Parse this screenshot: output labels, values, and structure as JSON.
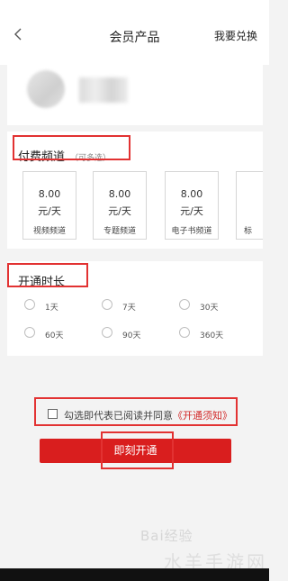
{
  "header": {
    "title": "会员产品",
    "redeem_link": "我要兑换",
    "back_icon": "chevron-left-icon"
  },
  "profile": {
    "avatar": "avatar-blurred",
    "username": ""
  },
  "channels": {
    "title": "付费频道",
    "hint": "（可多选）",
    "items": [
      {
        "price": "8.00",
        "unit": "元/天",
        "name": "视频频道"
      },
      {
        "price": "8.00",
        "unit": "元/天",
        "name": "专题频道"
      },
      {
        "price": "8.00",
        "unit": "元/天",
        "name": "电子书频道"
      },
      {
        "price": "",
        "unit": "",
        "name": "标"
      }
    ]
  },
  "duration": {
    "title": "开通时长",
    "options": [
      {
        "label": "1天"
      },
      {
        "label": "7天"
      },
      {
        "label": "30天"
      },
      {
        "label": "60天"
      },
      {
        "label": "90天"
      },
      {
        "label": "360天"
      }
    ]
  },
  "agreement": {
    "text": "勾选即代表已阅读并同意",
    "link": "《开通须知》"
  },
  "action": {
    "open_button": "即刻开通"
  },
  "watermark": {
    "text": "Bai经验",
    "text2": "水羊手游网"
  },
  "colors": {
    "accent": "#d91e1e",
    "highlight_box": "#e23232",
    "background": "#f3f3f3"
  }
}
